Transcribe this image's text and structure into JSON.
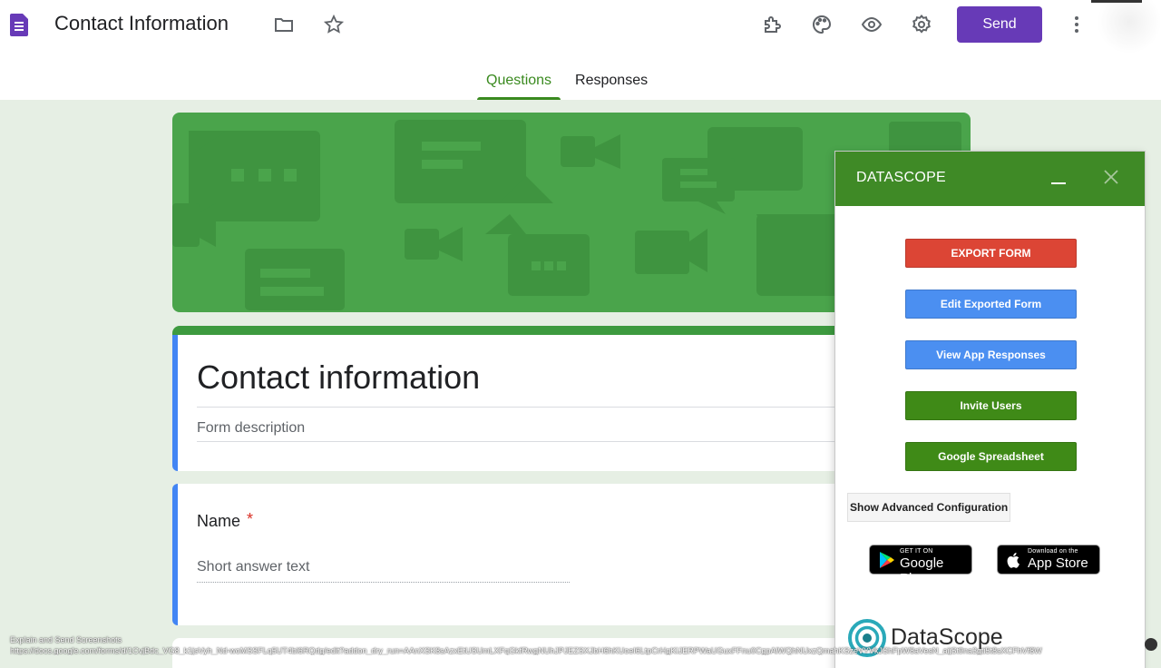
{
  "header": {
    "title": "Contact Information",
    "send_label": "Send",
    "icons": [
      "folder-icon",
      "star-icon",
      "addon-icon",
      "palette-icon",
      "preview-icon",
      "settings-icon",
      "more-icon"
    ]
  },
  "tabs": [
    {
      "label": "Questions",
      "active": true
    },
    {
      "label": "Responses",
      "active": false
    }
  ],
  "form": {
    "title": "Contact information",
    "description_placeholder": "Form description",
    "questions": [
      {
        "label": "Name",
        "required_mark": "*",
        "answer_placeholder": "Short answer text"
      }
    ]
  },
  "panel": {
    "title": "DATASCOPE",
    "buttons": {
      "export": "EXPORT FORM",
      "edit": "Edit Exported Form",
      "view": "View App Responses",
      "invite": "Invite Users",
      "sheet": "Google Spreadsheet"
    },
    "advanced": "Show Advanced Configuration",
    "google_play": {
      "small": "GET IT ON",
      "big": "Google Play"
    },
    "app_store": {
      "small": "Download on the",
      "big": "App Store"
    },
    "brand": "DataScope"
  },
  "overlay": {
    "line1": "Explain and Send Screenshots",
    "line2": "https://docs.google.com/forms/d/1CvjBdc_VG8_k1jsVyh_Nd-woMSSFLq5UT4bl6RQdg/edit?addon_dry_run=AAnXSK8sAzxEtUSUmLXFqGkfRwgNUhJPJEZSXJbH6hKUoeI6LtpCrHgKIJERPWaUGuxFFnu0CgpAlWQhNUxzQmahKSzeVYVkJShFpW8aVesN_aijSt9na3gti5t8sXCFhVf8W"
  },
  "colors": {
    "brand_purple": "#673ab7",
    "form_green": "#3d9a3f",
    "panel_green": "#3f8a26",
    "export_red": "#dc4535",
    "action_blue": "#4b8ff1",
    "action_green": "#3f8a17"
  }
}
